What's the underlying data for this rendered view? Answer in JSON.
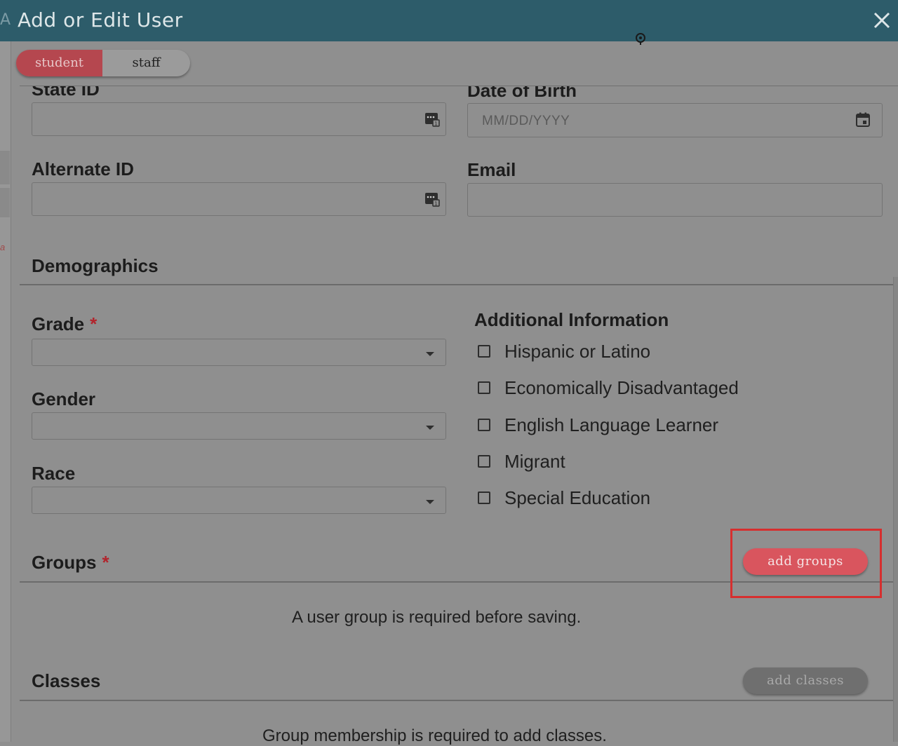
{
  "dialog": {
    "title": "Add or Edit User",
    "ghost_left": "A",
    "ghost_left_italic": "a"
  },
  "role_toggle": {
    "options": [
      "student",
      "staff"
    ],
    "selected": "student"
  },
  "fields": {
    "state_id": {
      "label": "State ID",
      "value": ""
    },
    "date_of_birth": {
      "label": "Date of Birth",
      "placeholder": "MM/DD/YYYY"
    },
    "alternate_id": {
      "label": "Alternate ID",
      "value": ""
    },
    "email": {
      "label": "Email",
      "value": ""
    }
  },
  "demographics": {
    "heading": "Demographics",
    "grade": {
      "label": "Grade",
      "required_mark": "*",
      "value": ""
    },
    "gender": {
      "label": "Gender",
      "value": ""
    },
    "race": {
      "label": "Race",
      "value": ""
    },
    "additional_info": {
      "heading": "Additional Information",
      "options": [
        {
          "label": "Hispanic or Latino",
          "checked": false
        },
        {
          "label": "Economically Disadvantaged",
          "checked": false
        },
        {
          "label": "English Language Learner",
          "checked": false
        },
        {
          "label": "Migrant",
          "checked": false
        },
        {
          "label": "Special Education",
          "checked": false
        }
      ]
    }
  },
  "groups": {
    "heading": "Groups",
    "required_mark": "*",
    "add_button": "add groups",
    "message": "A user group is required before saving."
  },
  "classes": {
    "heading": "Classes",
    "add_button": "add classes",
    "message": "Group membership is required to add classes."
  },
  "colors": {
    "titlebar": "#2d5c6a",
    "accent": "#d9555e",
    "required": "#b1252d",
    "highlight": "#d62f2f"
  }
}
